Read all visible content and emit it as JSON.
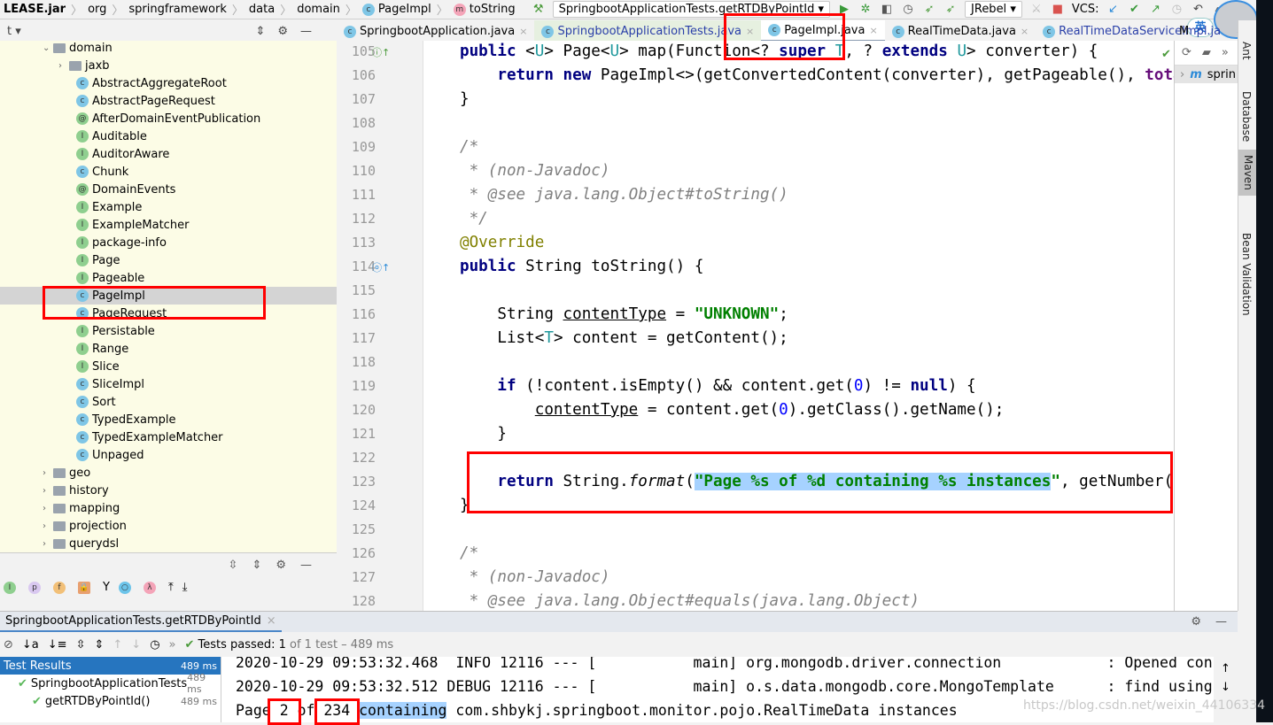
{
  "breadcrumb": [
    "LEASE.jar",
    "org",
    "springframework",
    "data",
    "domain",
    "PageImpl",
    "toString"
  ],
  "run_config": {
    "name": "SpringbootApplicationTests.getRTDByPointId",
    "jrebel": "JRebel",
    "vcs_label": "VCS:"
  },
  "ime_badge": "英",
  "project_header": "t",
  "editor_tabs": [
    {
      "label": "SpringbootApplication.java",
      "style": ""
    },
    {
      "label": "SpringbootApplicationTests.java",
      "style": "test"
    },
    {
      "label": "PageImpl.java",
      "style": "active"
    },
    {
      "label": "RealTimeData.java",
      "style": ""
    },
    {
      "label": "RealTimeDataServiceImpl.ja",
      "style": "blue"
    }
  ],
  "maven_header": "M",
  "tree": [
    {
      "label": "domain",
      "type": "folder",
      "depth": 1,
      "expanded": true
    },
    {
      "label": "jaxb",
      "type": "folder",
      "depth": 2,
      "expanded": false
    },
    {
      "label": "AbstractAggregateRoot",
      "type": "c",
      "depth": 3
    },
    {
      "label": "AbstractPageRequest",
      "type": "c",
      "depth": 3
    },
    {
      "label": "AfterDomainEventPublication",
      "type": "at",
      "depth": 3
    },
    {
      "label": "Auditable",
      "type": "i",
      "depth": 3
    },
    {
      "label": "AuditorAware",
      "type": "i",
      "depth": 3
    },
    {
      "label": "Chunk",
      "type": "c",
      "depth": 3
    },
    {
      "label": "DomainEvents",
      "type": "at",
      "depth": 3
    },
    {
      "label": "Example",
      "type": "i",
      "depth": 3
    },
    {
      "label": "ExampleMatcher",
      "type": "i",
      "depth": 3
    },
    {
      "label": "package-info",
      "type": "i",
      "depth": 3
    },
    {
      "label": "Page",
      "type": "i",
      "depth": 3
    },
    {
      "label": "Pageable",
      "type": "i",
      "depth": 3
    },
    {
      "label": "PageImpl",
      "type": "c",
      "depth": 3,
      "selected": true
    },
    {
      "label": "PageRequest",
      "type": "c",
      "depth": 3
    },
    {
      "label": "Persistable",
      "type": "i",
      "depth": 3
    },
    {
      "label": "Range",
      "type": "i",
      "depth": 3
    },
    {
      "label": "Slice",
      "type": "i",
      "depth": 3
    },
    {
      "label": "SliceImpl",
      "type": "c",
      "depth": 3
    },
    {
      "label": "Sort",
      "type": "c",
      "depth": 3
    },
    {
      "label": "TypedExample",
      "type": "c",
      "depth": 3
    },
    {
      "label": "TypedExampleMatcher",
      "type": "c",
      "depth": 3
    },
    {
      "label": "Unpaged",
      "type": "c",
      "depth": 3
    },
    {
      "label": "geo",
      "type": "folder",
      "depth": 1,
      "expanded": false
    },
    {
      "label": "history",
      "type": "folder",
      "depth": 1,
      "expanded": false
    },
    {
      "label": "mapping",
      "type": "folder",
      "depth": 1,
      "expanded": false
    },
    {
      "label": "projection",
      "type": "folder",
      "depth": 1,
      "expanded": false
    },
    {
      "label": "querydsl",
      "type": "folder",
      "depth": 1,
      "expanded": false
    }
  ],
  "code": [
    {
      "n": "105",
      "s": [
        [
          "kw",
          "public "
        ],
        [
          "",
          "<"
        ],
        [
          "tp",
          "U"
        ],
        [
          "",
          "> Page<"
        ],
        [
          "tp",
          "U"
        ],
        [
          "",
          "> map(Function<? "
        ],
        [
          "kw",
          "super "
        ],
        [
          "tp",
          "T"
        ],
        [
          "",
          ", ? "
        ],
        [
          "kw",
          "extends "
        ],
        [
          "tp",
          "U"
        ],
        [
          "",
          "> converter) {"
        ]
      ]
    },
    {
      "n": "106",
      "s": [
        [
          "",
          "    "
        ],
        [
          "kw",
          "return new "
        ],
        [
          "",
          "PageImpl<>(getConvertedContent(converter), getPageable(), "
        ],
        [
          "fld",
          "total"
        ],
        [
          "",
          ");"
        ]
      ]
    },
    {
      "n": "107",
      "s": [
        [
          "",
          "}"
        ]
      ]
    },
    {
      "n": "108",
      "s": []
    },
    {
      "n": "109",
      "s": [
        [
          "cm",
          "/*"
        ]
      ]
    },
    {
      "n": "110",
      "s": [
        [
          "cm",
          " * (non-Javadoc)"
        ]
      ]
    },
    {
      "n": "111",
      "s": [
        [
          "cm",
          " * @see java.lang.Object#toString()"
        ]
      ]
    },
    {
      "n": "112",
      "s": [
        [
          "cm",
          " */"
        ]
      ]
    },
    {
      "n": "113",
      "s": [
        [
          "an",
          "@Override"
        ]
      ]
    },
    {
      "n": "114",
      "s": [
        [
          "kw",
          "public "
        ],
        [
          "",
          "String toString() {"
        ]
      ]
    },
    {
      "n": "115",
      "s": []
    },
    {
      "n": "116",
      "s": [
        [
          "",
          "    String "
        ],
        [
          "ul",
          "contentType"
        ],
        [
          "",
          " = "
        ],
        [
          "str",
          "\"UNKNOWN\""
        ],
        [
          "",
          ";"
        ]
      ]
    },
    {
      "n": "117",
      "s": [
        [
          "",
          "    List<"
        ],
        [
          "tp",
          "T"
        ],
        [
          "",
          "> content = getContent();"
        ]
      ]
    },
    {
      "n": "118",
      "s": []
    },
    {
      "n": "119",
      "s": [
        [
          "",
          "    "
        ],
        [
          "kw",
          "if "
        ],
        [
          "",
          "(!content.isEmpty() && content.get("
        ],
        [
          "num",
          "0"
        ],
        [
          "",
          ") != "
        ],
        [
          "kw",
          "null"
        ],
        [
          "",
          ") {"
        ]
      ]
    },
    {
      "n": "120",
      "s": [
        [
          "",
          "        "
        ],
        [
          "ul",
          "contentType"
        ],
        [
          "",
          " = content.get("
        ],
        [
          "num",
          "0"
        ],
        [
          "",
          ").getClass().getName();"
        ]
      ]
    },
    {
      "n": "121",
      "s": [
        [
          "",
          "    }"
        ]
      ]
    },
    {
      "n": "122",
      "s": []
    },
    {
      "n": "123",
      "s": [
        [
          "",
          "    "
        ],
        [
          "kw",
          "return "
        ],
        [
          "",
          "String."
        ],
        [
          "it",
          "format"
        ],
        [
          "",
          "("
        ],
        [
          "str hl",
          "\"Page %s of %d containing %s instances"
        ],
        [
          "str",
          "\""
        ],
        [
          "",
          ", getNumber() +"
        ]
      ]
    },
    {
      "n": "124",
      "s": [
        [
          "",
          "}"
        ]
      ]
    },
    {
      "n": "125",
      "s": []
    },
    {
      "n": "126",
      "s": [
        [
          "cm",
          "/*"
        ]
      ]
    },
    {
      "n": "127",
      "s": [
        [
          "cm",
          " * (non-Javadoc)"
        ]
      ]
    },
    {
      "n": "128",
      "s": [
        [
          "cm",
          " * @see java.lang.Object#equals(java.lang.Object)"
        ]
      ]
    }
  ],
  "maven": {
    "project": "sprin"
  },
  "right_tools": [
    "Ant",
    "Database",
    "Maven",
    "Bean Validation"
  ],
  "run_panel": {
    "tab": "SpringbootApplicationTests.getRTDByPointId",
    "status_prefix": "Tests passed:",
    "status_count": "1",
    "status_rest": "of 1 test – 489 ms",
    "results": [
      {
        "label": "Test Results",
        "ms": "489 ms",
        "depth": 0,
        "selected": true
      },
      {
        "label": "SpringbootApplicationTests",
        "ms": "489 ms",
        "depth": 1
      },
      {
        "label": "getRTDByPointId()",
        "ms": "489 ms",
        "depth": 2
      }
    ],
    "console": [
      "2020-10-29 09:53:32.468  INFO 12116 --- [           main] org.mongodb.driver.connection            : Opened con",
      "2020-10-29 09:53:32.512 DEBUG 12116 --- [           main] o.s.data.mongodb.core.MongoTemplate      : find using"
    ],
    "output": {
      "page": "Page",
      "num": "2",
      "of": "of",
      "total": "234",
      "containing": "containing",
      "rest": " com.shbykj.springboot.monitor.pojo.RealTimeData instances"
    }
  },
  "watermark": "https://blog.csdn.net/weixin_44106334"
}
